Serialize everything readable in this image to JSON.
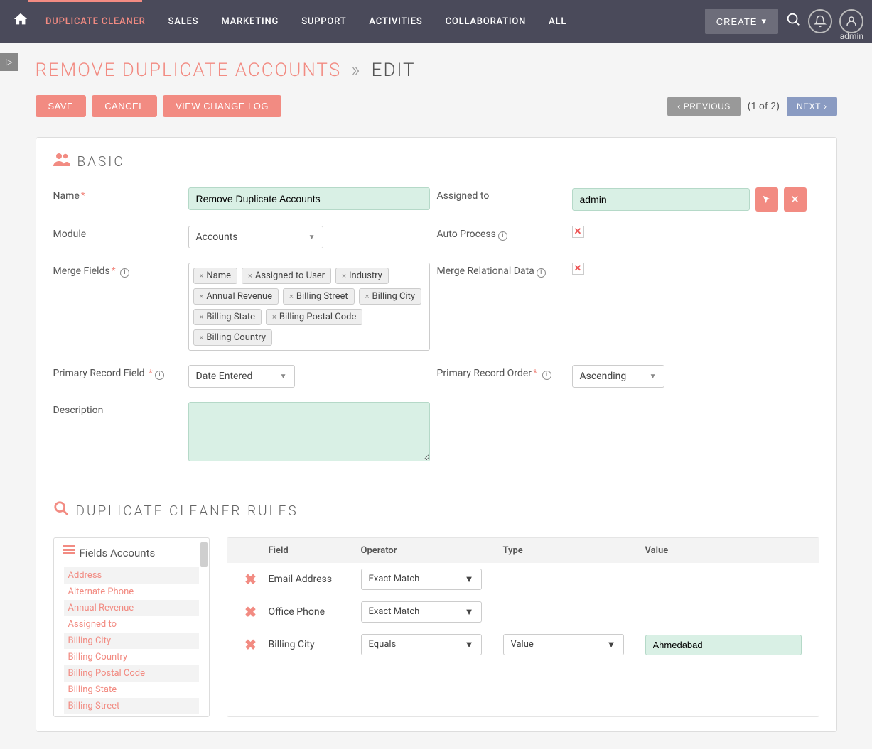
{
  "topbar": {
    "nav": [
      "DUPLICATE CLEANER",
      "SALES",
      "MARKETING",
      "SUPPORT",
      "ACTIVITIES",
      "COLLABORATION",
      "ALL"
    ],
    "active_index": 0,
    "create_label": "CREATE",
    "user_label": "admin"
  },
  "page": {
    "title_accent": "REMOVE DUPLICATE ACCOUNTS",
    "title_sep": "»",
    "title_rest": "EDIT"
  },
  "actions": {
    "save": "SAVE",
    "cancel": "CANCEL",
    "changelog": "VIEW CHANGE LOG",
    "previous": "PREVIOUS",
    "page_info": "(1 of 2)",
    "next": "NEXT"
  },
  "basic": {
    "section_title": "BASIC",
    "labels": {
      "name": "Name",
      "assigned_to": "Assigned to",
      "module": "Module",
      "auto_process": "Auto Process",
      "merge_fields": "Merge Fields",
      "merge_relational": "Merge Relational Data",
      "primary_field": "Primary Record Field",
      "primary_order": "Primary Record Order",
      "description": "Description"
    },
    "values": {
      "name": "Remove Duplicate Accounts",
      "assigned_to": "admin",
      "module": "Accounts",
      "primary_field": "Date Entered",
      "primary_order": "Ascending"
    },
    "merge_tags": [
      "Name",
      "Assigned to User",
      "Industry",
      "Annual Revenue",
      "Billing Street",
      "Billing City",
      "Billing State",
      "Billing Postal Code",
      "Billing Country"
    ]
  },
  "rules": {
    "section_title": "DUPLICATE CLEANER RULES",
    "fields_panel_title": "Fields Accounts",
    "field_list": [
      "Address",
      "Alternate Phone",
      "Annual Revenue",
      "Assigned to",
      "Billing City",
      "Billing Country",
      "Billing Postal Code",
      "Billing State",
      "Billing Street"
    ],
    "columns": {
      "field": "Field",
      "operator": "Operator",
      "type": "Type",
      "value": "Value"
    },
    "rows": [
      {
        "field": "Email Address",
        "operator": "Exact Match",
        "type": "",
        "value": ""
      },
      {
        "field": "Office Phone",
        "operator": "Exact Match",
        "type": "",
        "value": ""
      },
      {
        "field": "Billing City",
        "operator": "Equals",
        "type": "Value",
        "value": "Ahmedabad"
      }
    ]
  }
}
